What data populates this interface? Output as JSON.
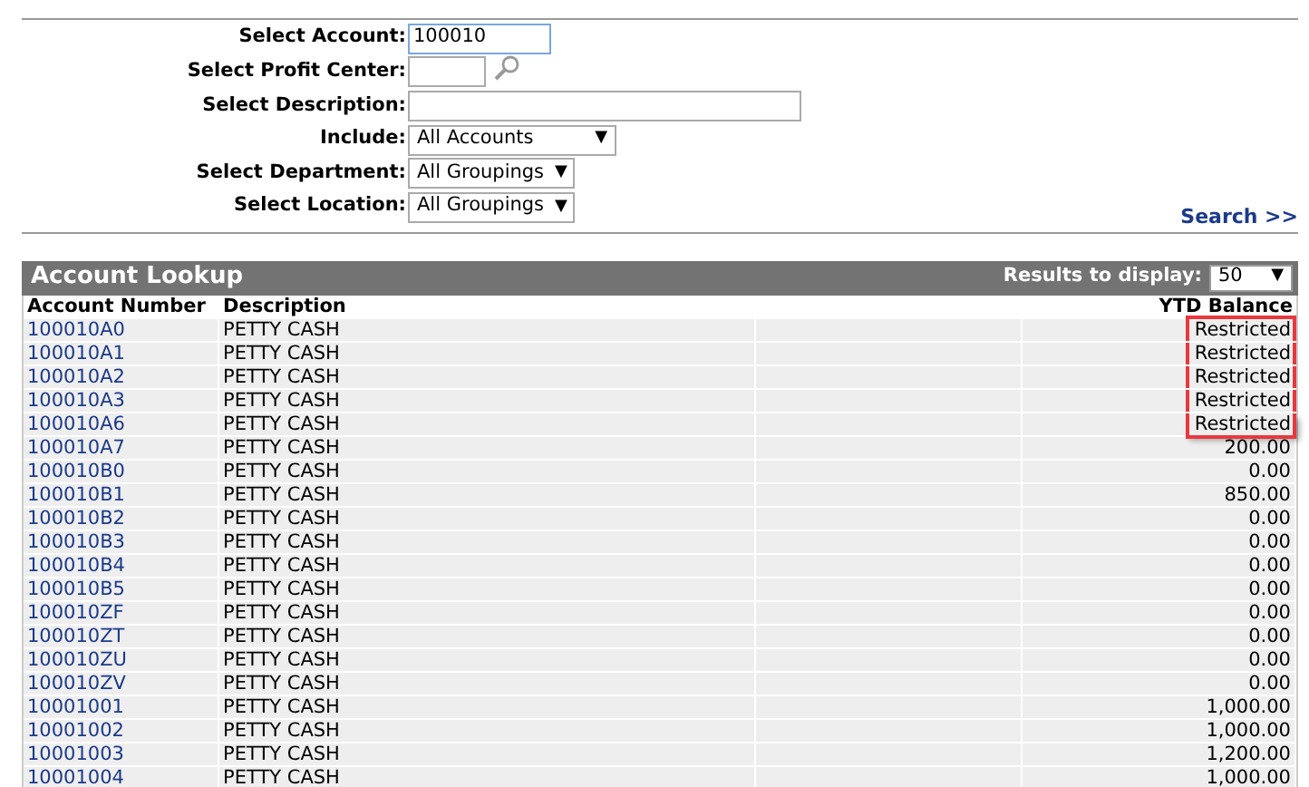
{
  "form": {
    "fields": [
      {
        "kind": "text",
        "label": "Select Account:",
        "value": "100010",
        "focused": true
      },
      {
        "kind": "lookup",
        "label": "Select Profit Center:",
        "focused": false
      },
      {
        "kind": "text",
        "label": "Select Description:",
        "focused": false
      },
      {
        "kind": "select",
        "label": "Include:",
        "value": "All Accounts",
        "arrow": "▼"
      },
      {
        "kind": "select",
        "label": "Select Department:",
        "value": "All Groupings",
        "arrow": "▼"
      },
      {
        "kind": "select",
        "label": "Select Location:",
        "value": "All Groupings",
        "arrow": "▼"
      }
    ],
    "search_link": "Search >>"
  },
  "results": {
    "title": "Account Lookup",
    "display_label": "Results to display:",
    "display_value": "50",
    "display_arrow": "▼",
    "columns": [
      "Account Number",
      "Description",
      "YTD Balance"
    ],
    "rows": [
      {
        "account": "100010A0",
        "description": "PETTY CASH",
        "balance": "Restricted",
        "highlighted": true
      },
      {
        "account": "100010A1",
        "description": "PETTY CASH",
        "balance": "Restricted",
        "highlighted": true
      },
      {
        "account": "100010A2",
        "description": "PETTY CASH",
        "balance": "Restricted",
        "highlighted": true
      },
      {
        "account": "100010A3",
        "description": "PETTY CASH",
        "balance": "Restricted",
        "highlighted": true
      },
      {
        "account": "100010A6",
        "description": "PETTY CASH",
        "balance": "Restricted",
        "highlighted": true
      },
      {
        "account": "100010A7",
        "description": "PETTY CASH",
        "balance": "200.00",
        "highlighted": false
      },
      {
        "account": "100010B0",
        "description": "PETTY CASH",
        "balance": "0.00",
        "highlighted": false
      },
      {
        "account": "100010B1",
        "description": "PETTY CASH",
        "balance": "850.00",
        "highlighted": false
      },
      {
        "account": "100010B2",
        "description": "PETTY CASH",
        "balance": "0.00",
        "highlighted": false
      },
      {
        "account": "100010B3",
        "description": "PETTY CASH",
        "balance": "0.00",
        "highlighted": false
      },
      {
        "account": "100010B4",
        "description": "PETTY CASH",
        "balance": "0.00",
        "highlighted": false
      },
      {
        "account": "100010B5",
        "description": "PETTY CASH",
        "balance": "0.00",
        "highlighted": false
      },
      {
        "account": "100010ZF",
        "description": "PETTY CASH",
        "balance": "0.00",
        "highlighted": false
      },
      {
        "account": "100010ZT",
        "description": "PETTY CASH",
        "balance": "0.00",
        "highlighted": false
      },
      {
        "account": "100010ZU",
        "description": "PETTY CASH",
        "balance": "0.00",
        "highlighted": false
      },
      {
        "account": "100010ZV",
        "description": "PETTY CASH",
        "balance": "0.00",
        "highlighted": false
      },
      {
        "account": "10001001",
        "description": "PETTY CASH",
        "balance": "1,000.00",
        "highlighted": false
      },
      {
        "account": "10001002",
        "description": "PETTY CASH",
        "balance": "1,000.00",
        "highlighted": false
      },
      {
        "account": "10001003",
        "description": "PETTY CASH",
        "balance": "1,200.00",
        "highlighted": false
      },
      {
        "account": "10001004",
        "description": "PETTY CASH",
        "balance": "1,000.00",
        "highlighted": false
      }
    ]
  }
}
